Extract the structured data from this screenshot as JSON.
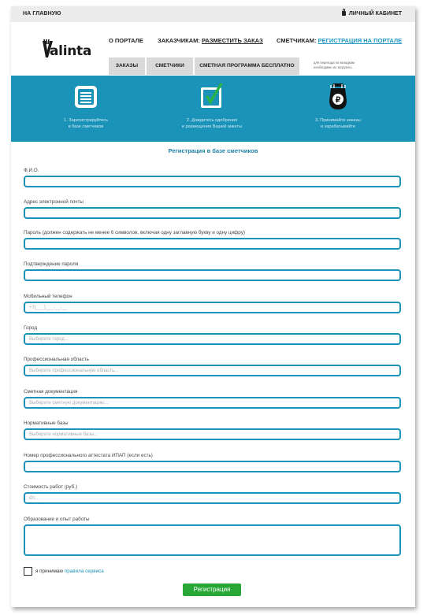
{
  "topbar": {
    "home": "НА ГЛАВНУЮ",
    "cabinet": "ЛИЧНЫЙ КАБИНЕТ"
  },
  "logo": {
    "text": "alinta"
  },
  "nav": {
    "about": "О ПОРТАЛЕ",
    "clients_prefix": "ЗАКАЗЧИКАМ:",
    "clients_link": "РАЗМЕСТИТЬ ЗАКАЗ",
    "estimators_prefix": "СМЕТЧИКАМ:",
    "estimators_link": "РЕГИСТРАЦИЯ НА ПОРТАЛЕ"
  },
  "tabs": [
    "ЗАКАЗЫ",
    "СМЕТЧИКИ",
    "СМЕТНАЯ ПРОГРАММА БЕСПЛАТНО"
  ],
  "tab_note": "для перехода по вкладкам\nнеобходимо их загрузить",
  "steps": [
    {
      "icon": "list-icon",
      "label": "1. Зарегистрируйтесь\nв базе сметчиков"
    },
    {
      "icon": "check-icon",
      "label": "2. Дождитесь одобрения\nи размещения Вашей анкеты"
    },
    {
      "icon": "money-bag-icon",
      "label": "3. Принимайте заказы\nи зарабатывайте"
    }
  ],
  "form": {
    "title": "Регистрация в базе сметчиков",
    "fields": [
      {
        "name": "fio",
        "label": "Ф.И.О.",
        "placeholder": ""
      },
      {
        "name": "email",
        "label": "Адрес электронной почты",
        "placeholder": ""
      },
      {
        "name": "password",
        "label": "Пароль (должен содержать не менее 6 символов, включая одну заглавную букву и одну цифру)",
        "placeholder": ""
      },
      {
        "name": "password-confirm",
        "label": "Подтверждение пароля",
        "placeholder": ""
      },
      {
        "name": "phone",
        "label": "Мобильный телефон",
        "placeholder": "+7(___)___-__-__"
      },
      {
        "name": "city",
        "label": "Город",
        "placeholder": "Выберите город..."
      },
      {
        "name": "prof-area",
        "label": "Профессиональная область",
        "placeholder": "Выберите профессиональную область..."
      },
      {
        "name": "estimate-docs",
        "label": "Сметная документация",
        "placeholder": "Выберите сметную документацию..."
      },
      {
        "name": "norm-bases",
        "label": "Нормативные базы",
        "placeholder": "Выберите нормативные базы..."
      },
      {
        "name": "ipap",
        "label": "Номер профессионального аттестата ИПАП (если есть)",
        "placeholder": ""
      },
      {
        "name": "cost",
        "label": "Стоимость работ (руб.)",
        "placeholder": "От..."
      },
      {
        "name": "education",
        "label": "Образование и опыт работы",
        "placeholder": ""
      }
    ],
    "agree_text": "я принимаю",
    "agree_link": "правила сервиса",
    "submit": "Регистрация"
  },
  "colors": {
    "accent": "#1b93b8",
    "green": "#27a836",
    "tab_gray": "#d9d9d9"
  }
}
